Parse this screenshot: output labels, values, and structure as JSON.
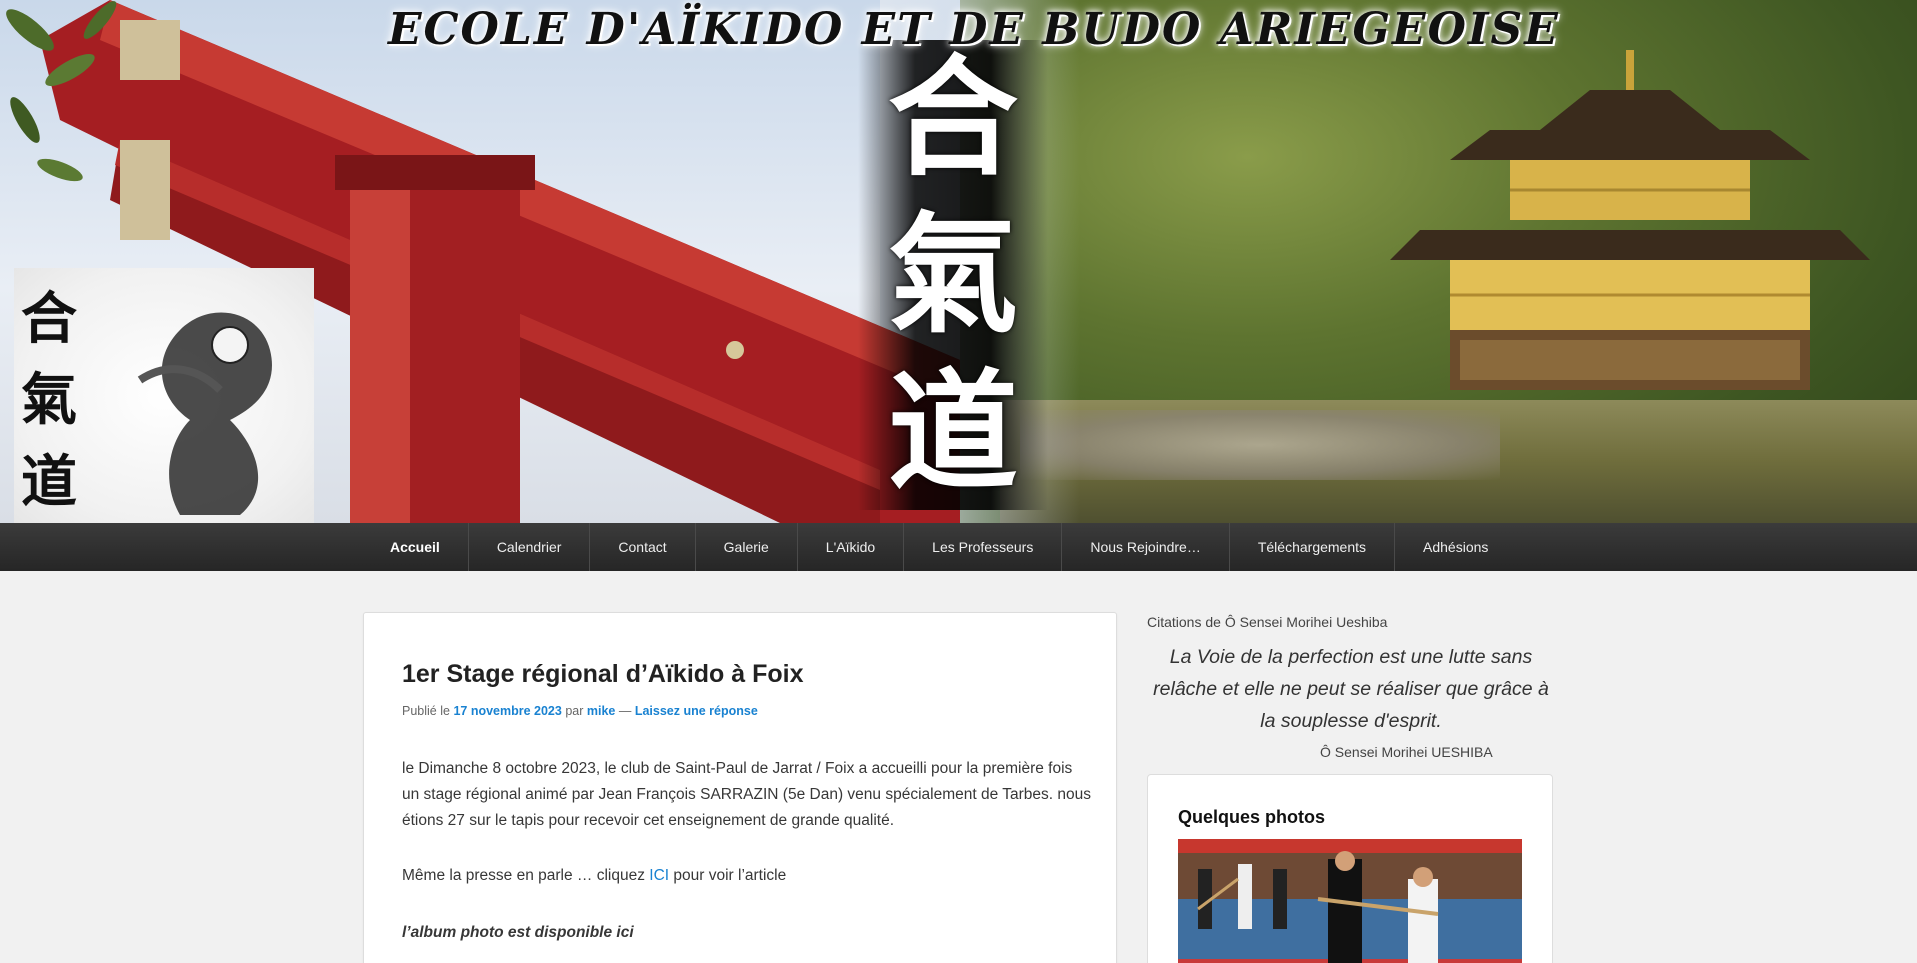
{
  "banner": {
    "title": "ECOLE D'AÏKIDO ET DE BUDO ARIEGEOISE",
    "kanji": [
      "合",
      "氣",
      "道"
    ]
  },
  "nav": {
    "items": [
      {
        "label": "Accueil",
        "active": true
      },
      {
        "label": "Calendrier"
      },
      {
        "label": "Contact"
      },
      {
        "label": "Galerie"
      },
      {
        "label": "L'Aïkido"
      },
      {
        "label": "Les Professeurs"
      },
      {
        "label": "Nous Rejoindre…"
      },
      {
        "label": "Téléchargements"
      },
      {
        "label": "Adhésions"
      }
    ]
  },
  "article": {
    "title": "1er Stage régional d’Aïkido à Foix",
    "meta_prefix": "Publié le ",
    "date": "17 novembre 2023",
    "by": " par ",
    "author": "mike",
    "sep": " — ",
    "reply": "Laissez une réponse",
    "p1": "le Dimanche 8 octobre 2023, le club de Saint-Paul de Jarrat / Foix a accueilli pour la première fois un stage régional animé par Jean François SARRAZIN (5e Dan) venu spécialement de Tarbes. nous étions 27 sur le tapis pour recevoir cet enseignement de grande qualité.",
    "p2_before": "Même la presse en parle … cliquez ",
    "p2_link": "ICI",
    "p2_after": " pour voir l’article",
    "p3": "l’album photo est disponible ici"
  },
  "sidebar": {
    "quote_heading": "Citations de Ô Sensei Morihei Ueshiba",
    "quote": "La Voie de la perfection est une lutte sans relâche et elle ne peut se réaliser que grâce à la souplesse d'esprit.",
    "quote_author": "Ô Sensei Morihei UESHIBA",
    "widget_title": "Quelques photos"
  },
  "colors": {
    "link": "#1982d1",
    "nav_bg": "#262626",
    "page_bg": "#f1f1f1"
  }
}
